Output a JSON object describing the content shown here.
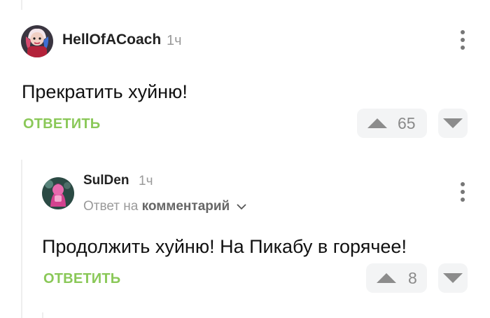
{
  "comments": [
    {
      "author": "HellOfACoach",
      "time": "1ч",
      "text": "Прекратить хуйню!",
      "reply_label": "ОТВЕТИТЬ",
      "rating": "65"
    },
    {
      "author": "SulDen",
      "time": "1ч",
      "reply_to_prefix": "Ответ на",
      "reply_to_target": "комментарий",
      "text": "Продолжить хуйню! На Пикабу в горячее!",
      "reply_label": "ОТВЕТИТЬ",
      "rating": "8"
    }
  ],
  "colors": {
    "reply_accent": "#8ac858",
    "vote_bg": "#f3f4f5",
    "thread_line": "#eeeeee"
  },
  "icons": [
    "more-vert-icon",
    "arrow-up-icon",
    "arrow-down-icon",
    "chevron-down-icon"
  ]
}
